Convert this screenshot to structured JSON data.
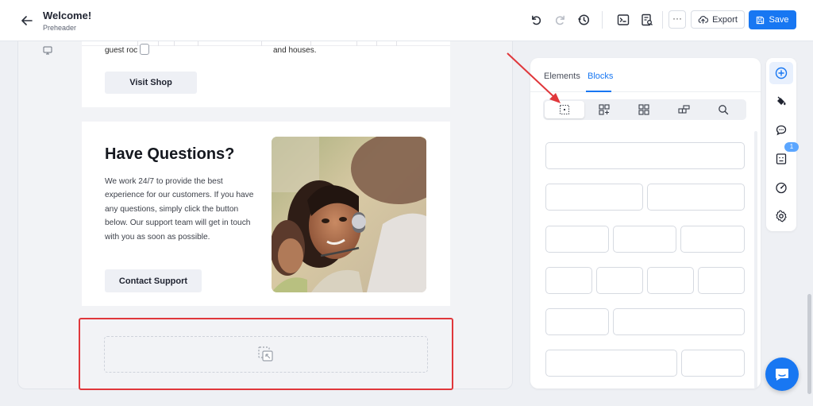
{
  "header": {
    "title": "Welcome!",
    "subtitle": "Preheader",
    "export_label": "Export",
    "save_label": "Save",
    "more_label": "···"
  },
  "canvas": {
    "top_block": {
      "text_left": "guest roc",
      "text_right": "and houses.",
      "button_label": "Visit Shop"
    },
    "questions_block": {
      "title": "Have Questions?",
      "body": "We work 24/7 to provide the best experience for our customers. If you have any questions, simply click the button below. Our support team will get in touch with you as soon as possible.",
      "button_label": "Contact Support"
    }
  },
  "panel": {
    "tabs": [
      {
        "label": "Elements",
        "active": false
      },
      {
        "label": "Blocks",
        "active": true
      }
    ],
    "categories": [
      "layout-icon",
      "add-grid-icon",
      "grid-icon",
      "columns-icon",
      "search-icon"
    ]
  },
  "rail": {
    "items": [
      "add-icon",
      "paint-bucket-icon",
      "comments-icon",
      "content-icon",
      "gauge-icon",
      "settings-icon"
    ],
    "badge_count": "1"
  },
  "colors": {
    "accent": "#1877f2",
    "annotation": "#e0373b",
    "canvas_bg": "#f2f3f6"
  }
}
